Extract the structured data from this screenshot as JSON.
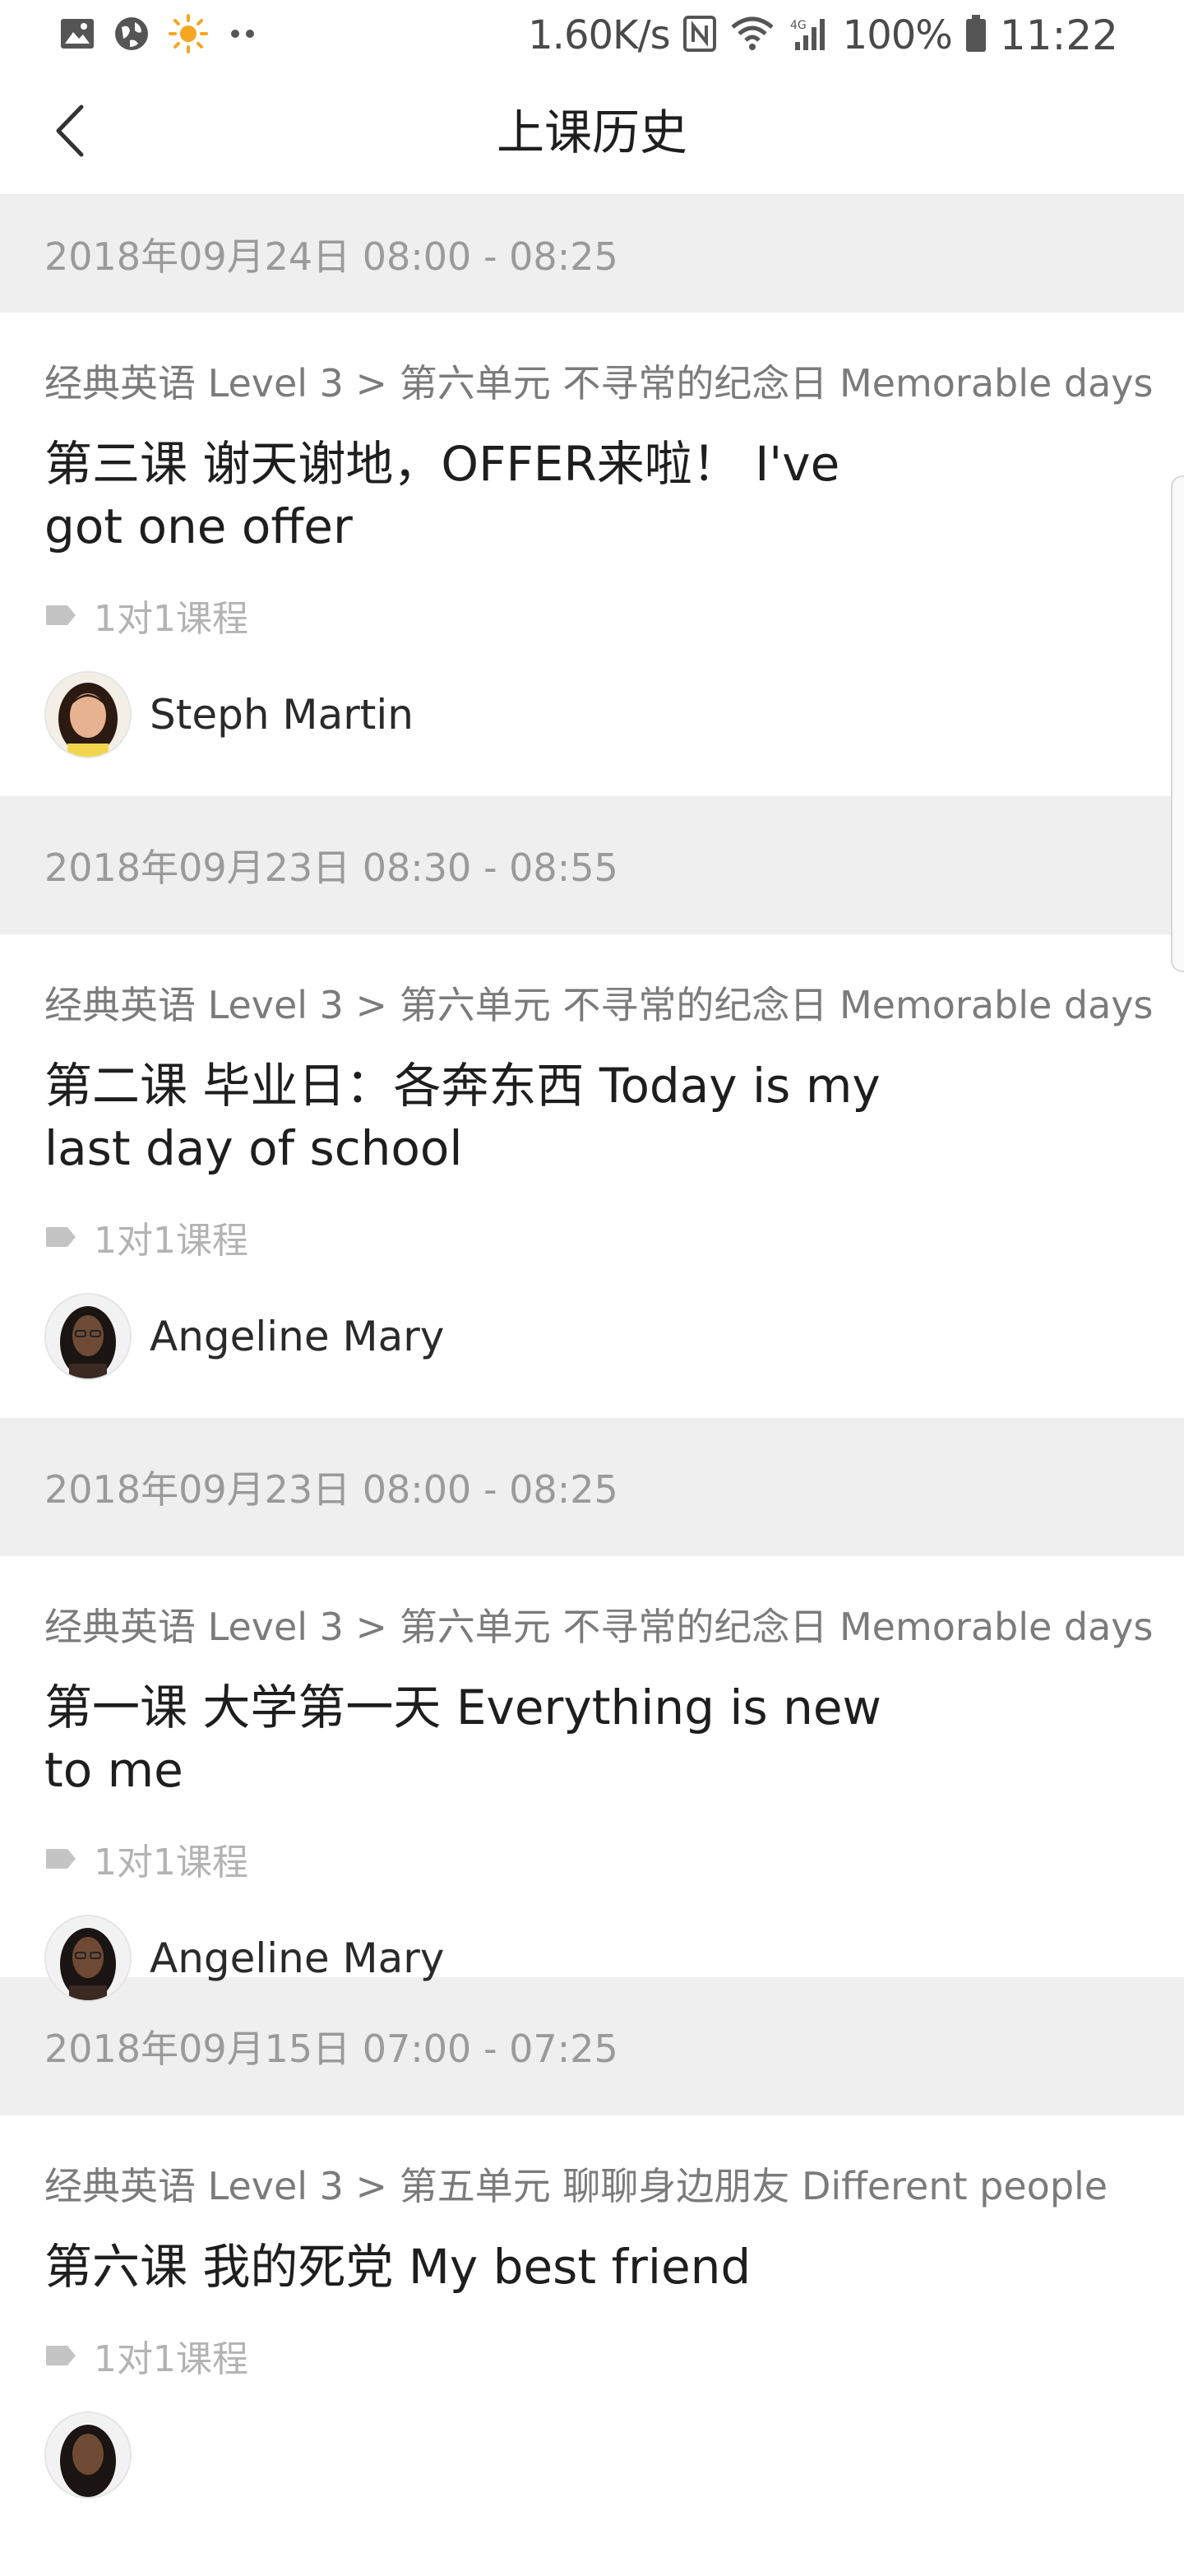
{
  "status_bar": {
    "speed": "1.60K/s",
    "battery": "100%",
    "time": "11:22",
    "network_label": "4G",
    "icons": [
      "image-icon",
      "globe-icon",
      "sun-icon",
      "more-dots-icon",
      "nfc-icon",
      "wifi-icon",
      "signal-icon",
      "battery-icon"
    ]
  },
  "header": {
    "title": "上课历史",
    "back_icon": "chevron-left-icon"
  },
  "lessons": [
    {
      "date": "2018年09月24日 08:00 - 08:25",
      "course_path": "经典英语 Level 3 > 第六单元 不寻常的纪念日 Memorable days",
      "title": "第三课 谢天谢地，OFFER来啦！ I've got one offer",
      "type": "1对1课程",
      "teacher": "Steph Martin"
    },
    {
      "date": "2018年09月23日 08:30 - 08:55",
      "course_path": "经典英语 Level 3 > 第六单元 不寻常的纪念日 Memorable days",
      "title": "第二课 毕业日：各奔东西 Today is my last day of school",
      "type": "1对1课程",
      "teacher": "Angeline Mary"
    },
    {
      "date": "2018年09月23日 08:00 - 08:25",
      "course_path": "经典英语 Level 3 > 第六单元 不寻常的纪念日 Memorable days",
      "title": "第一课 大学第一天 Everything is new to me",
      "type": "1对1课程",
      "teacher": "Angeline Mary"
    },
    {
      "date": "2018年09月15日 07:00 - 07:25",
      "course_path": "经典英语 Level 3 > 第五单元 聊聊身边朋友 Different people",
      "title": "第六课 我的死党 My best friend",
      "type": "1对1课程",
      "teacher": ""
    }
  ],
  "colors": {
    "date_header_bg": "#efefef",
    "date_text": "#9a9a9a",
    "path_text": "#7b7b7b",
    "title_text": "#1e1e1e",
    "tag_text": "#b3b3b3"
  }
}
